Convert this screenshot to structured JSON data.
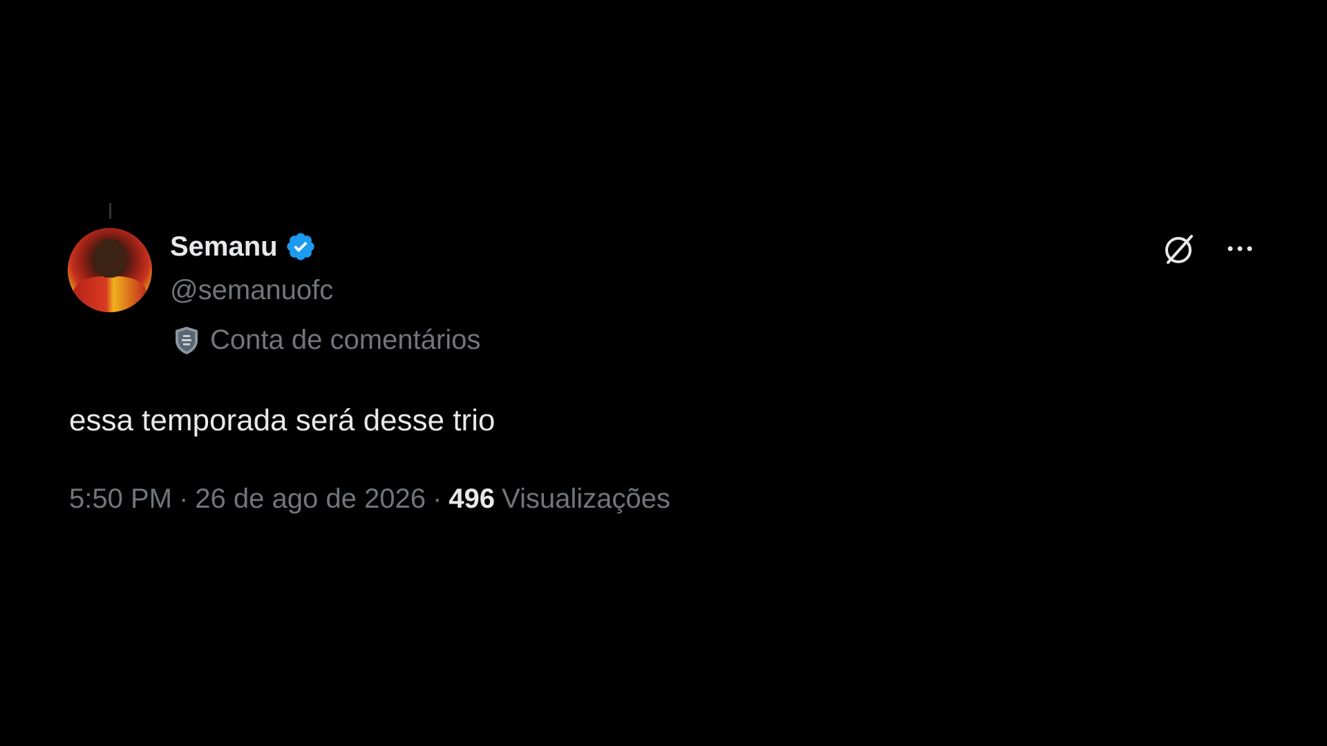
{
  "post": {
    "author": {
      "display_name": "Semanu",
      "handle": "@semanuofc",
      "verified": true,
      "verified_color": "#1d9bf0",
      "affiliation": "Conta de comentários",
      "avatar_icon": "avatar"
    },
    "text": "essa temporada será desse trio",
    "time": "5:50 PM",
    "date": "26 de ago de 2026",
    "separator": "·",
    "views_count": "496",
    "views_label": "Visualizações"
  },
  "actions": {
    "grok_icon": "grok-icon",
    "more_icon": "more-icon"
  },
  "colors": {
    "background": "#000000",
    "primary_text": "#e7e9ea",
    "secondary_text": "#71767b",
    "accent": "#1d9bf0"
  }
}
